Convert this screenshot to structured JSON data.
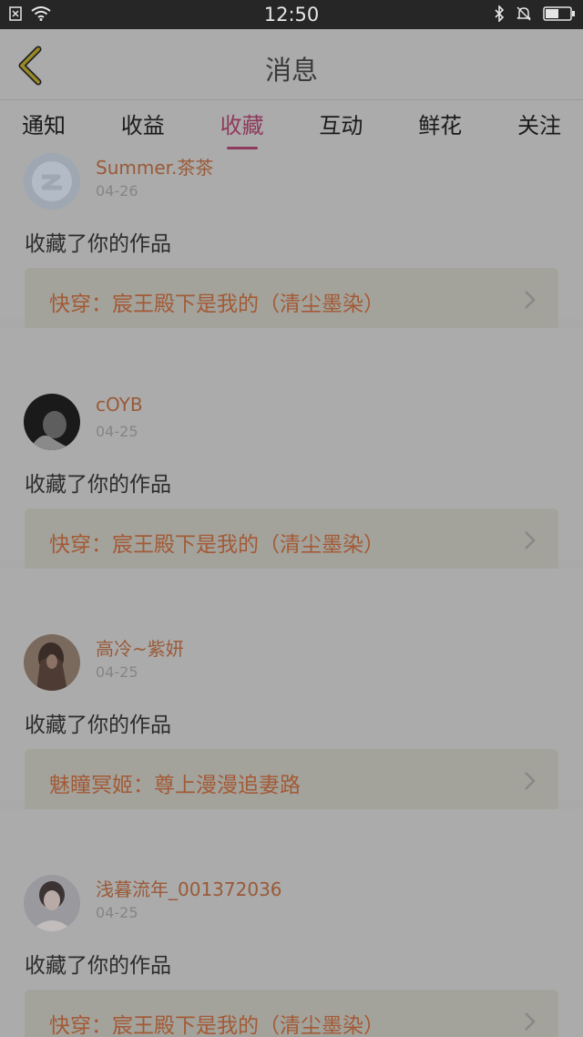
{
  "status_bar": {
    "time": "12:50",
    "icons": [
      "notification-x-icon",
      "wifi-icon",
      "bluetooth-icon",
      "mute-icon",
      "battery-icon"
    ]
  },
  "header": {
    "title": "消息"
  },
  "tabs": [
    {
      "label": "通知"
    },
    {
      "label": "收益"
    },
    {
      "label": "收藏"
    },
    {
      "label": "互动"
    },
    {
      "label": "鲜花"
    },
    {
      "label": "关注"
    }
  ],
  "active_tab": "收藏",
  "items": [
    {
      "user": "Summer.茶茶",
      "date": "04-26",
      "action": "收藏了你的作品",
      "work": "快穿：宸王殿下是我的（清尘墨染）"
    },
    {
      "user": "cOYB",
      "date": "04-25",
      "action": "收藏了你的作品",
      "work": "快穿：宸王殿下是我的（清尘墨染）"
    },
    {
      "user": "高冷~紫妍",
      "date": "04-25",
      "action": "收藏了你的作品",
      "work": "魅瞳冥姬：尊上漫漫追妻路"
    },
    {
      "user": "浅暮流年_001372036",
      "date": "04-25",
      "action": "收藏了你的作品",
      "work": "快穿：宸王殿下是我的（清尘墨染）"
    }
  ],
  "colors": {
    "accent": "#8e3a5c",
    "username": "#9a5a38",
    "work_title": "#a35a36",
    "overlay_background": "#ababab"
  }
}
